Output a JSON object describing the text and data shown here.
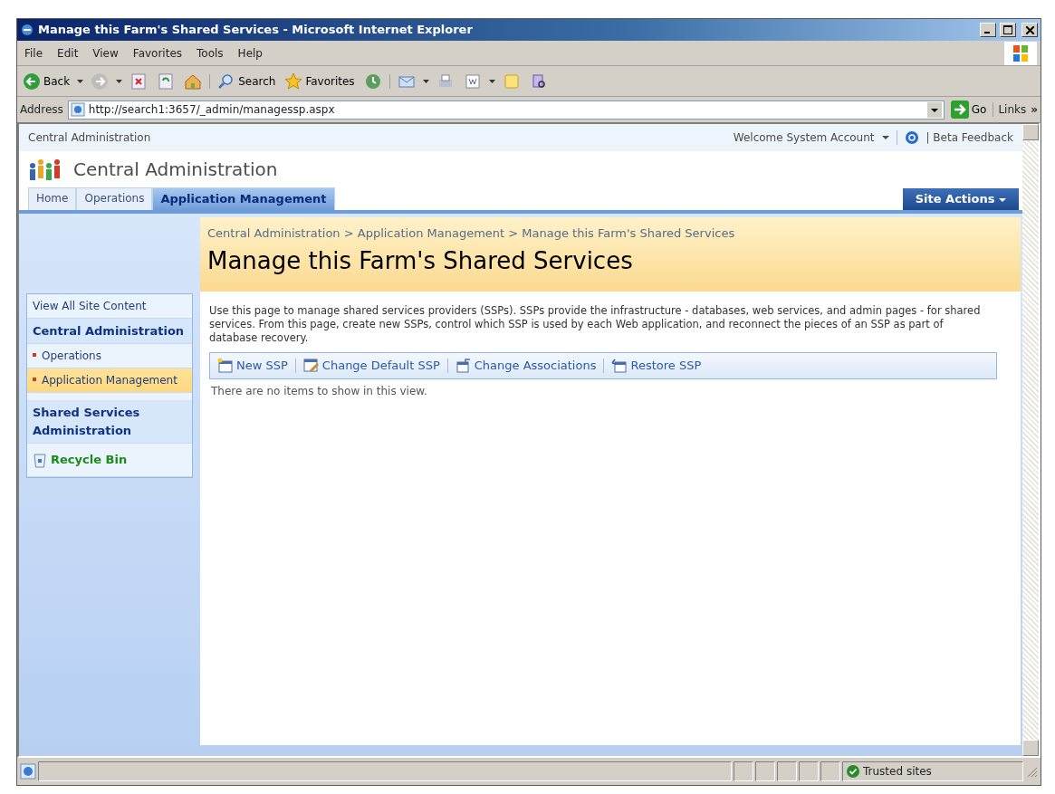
{
  "window": {
    "title": "Manage this Farm's Shared Services - Microsoft Internet Explorer"
  },
  "menu": [
    "File",
    "Edit",
    "View",
    "Favorites",
    "Tools",
    "Help"
  ],
  "toolbar": [
    {
      "kind": "back",
      "label": "Back"
    },
    {
      "kind": "forward"
    },
    {
      "kind": "stop"
    },
    {
      "kind": "refresh"
    },
    {
      "kind": "home"
    },
    {
      "kind": "search",
      "label": "Search"
    },
    {
      "kind": "favorites",
      "label": "Favorites"
    },
    {
      "kind": "history"
    },
    {
      "kind": "mail"
    },
    {
      "kind": "print"
    },
    {
      "kind": "edit"
    },
    {
      "kind": "discuss"
    },
    {
      "kind": "research"
    }
  ],
  "address": {
    "label": "Address",
    "value": "http://search1:3657/_admin/managessp.aspx",
    "go": "Go",
    "links": "Links",
    "more": "»"
  },
  "site": {
    "top_title": "Central Administration",
    "welcome": "Welcome System Account",
    "beta": "| Beta Feedback",
    "title": "Central Administration",
    "site_actions": "Site Actions"
  },
  "tabs": [
    {
      "label": "Home",
      "selected": false
    },
    {
      "label": "Operations",
      "selected": false
    },
    {
      "label": "Application Management",
      "selected": true
    }
  ],
  "breadcrumb": "Central Administration > Application Management > Manage this Farm's Shared Services",
  "page_title": "Manage this Farm's Shared Services",
  "sidebar": {
    "items": [
      {
        "kind": "link",
        "label": "View All Site Content"
      },
      {
        "kind": "heading",
        "label": "Central Administration"
      },
      {
        "kind": "sub",
        "label": "Operations",
        "selected": false
      },
      {
        "kind": "sub",
        "label": "Application Management",
        "selected": true
      },
      {
        "kind": "heading",
        "label": "Shared Services Administration"
      },
      {
        "kind": "recycle",
        "label": "Recycle Bin"
      }
    ]
  },
  "description": "Use this page to manage shared services providers (SSPs). SSPs provide the infrastructure - databases, web services, and admin pages - for shared services. From this page, create new SSPs, control which SSP is used by each Web application, and reconnect the pieces of an SSP as part of database recovery.",
  "actions": [
    {
      "kind": "new",
      "label": "New SSP"
    },
    {
      "kind": "edit",
      "label": "Change Default SSP"
    },
    {
      "kind": "assoc",
      "label": "Change Associations"
    },
    {
      "kind": "restore",
      "label": "Restore SSP"
    }
  ],
  "empty_message": "There are no items to show in this view.",
  "status_bar": {
    "zone": "Trusted sites"
  }
}
